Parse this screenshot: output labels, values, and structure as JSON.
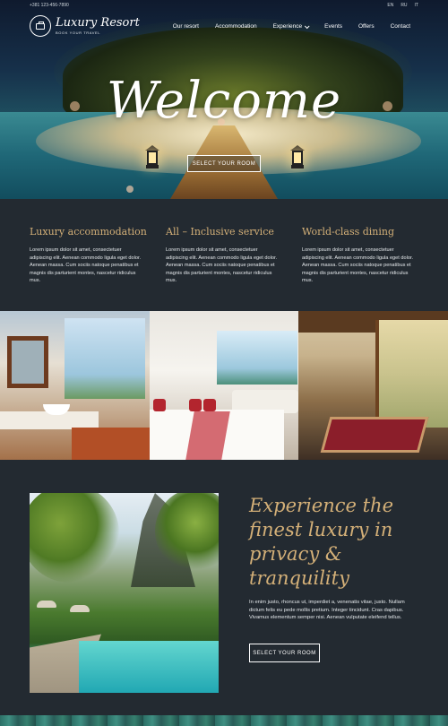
{
  "topbar": {
    "phone": "+381 123-456-7890",
    "languages": [
      "EN",
      "RU",
      "IT"
    ]
  },
  "logo": {
    "name": "Luxury Resort",
    "tagline": "BOOK YOUR TRAVEL"
  },
  "nav": {
    "items": [
      "Our resort",
      "Accommodation",
      "Experience",
      "Events",
      "Offers",
      "Contact"
    ]
  },
  "hero": {
    "title": "Welcome",
    "button_label": "SELECT YOUR ROOM"
  },
  "features": [
    {
      "title": "Luxury accommodation",
      "text": "Lorem ipsum dolor sit amet, consectetuer adipiscing elit. Aenean commodo ligula eget dolor. Aenean massa. Cum sociis natoque penatibus et magnis dis parturient montes, nascetur ridiculus mus."
    },
    {
      "title": "All – Inclusive service",
      "text": "Lorem ipsum dolor sit amet, consectetuer adipiscing elit. Aenean commodo ligula eget dolor. Aenean massa. Cum sociis natoque penatibus et magnis dis parturient montes, nascetur ridiculus mus."
    },
    {
      "title": "World-class dining",
      "text": "Lorem ipsum dolor sit amet, consectetuer adipiscing elit. Aenean commodo ligula eget dolor. Aenean massa. Cum sociis natoque penatibus et magnis dis parturient montes, nascetur ridiculus mus."
    }
  ],
  "promo": {
    "heading": "Experience the finest luxury in privacy & tranquility",
    "text": "In enim justo, rhoncus ut, imperdiet a, venenatis vitae, justo. Nullam dictum felis eu pede mollis pretium. Integer tincidunt. Cras dapibus. Vivamus elementum semper nisi. Aenean vulputate eleifend tellus.",
    "button_label": "SELECT YOUR ROOM"
  },
  "colors": {
    "background": "#232a31",
    "accent_gold": "#d4b078",
    "text_light": "#e4e8eb"
  },
  "icons": {
    "logo": "suitcase-icon",
    "dropdown": "chevron-down-icon"
  }
}
